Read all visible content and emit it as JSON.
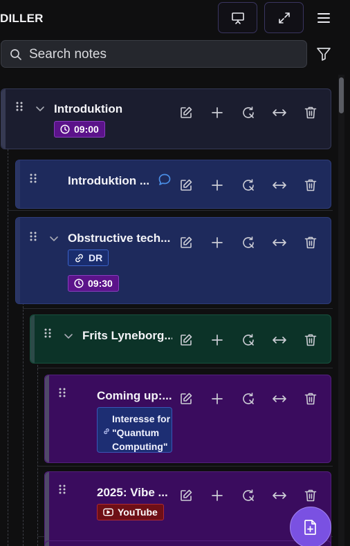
{
  "app": {
    "title": "DILLER"
  },
  "toolbar": {
    "present_icon": "presentation-icon",
    "fullscreen_icon": "expand-icon",
    "menu_icon": "hamburger-menu-icon"
  },
  "search": {
    "placeholder": "Search notes",
    "value": ""
  },
  "filter_icon": "filter-icon",
  "fab_icon": "add-note-icon",
  "colors": {
    "accent": "#7a51e2",
    "card_blue": "#1e2a5c",
    "card_green": "#0c3328",
    "card_purple": "#3a0c5e",
    "time_badge": "#5b138a",
    "youtube_badge": "#6e0f16"
  },
  "notes": [
    {
      "title": "Introduktion",
      "collapsible": true,
      "time": "09:00"
    },
    {
      "title": "Introduktion ...",
      "has_comment": true
    },
    {
      "title": "Obstructive tech...",
      "collapsible": true,
      "link_label": "DR",
      "time": "09:30"
    },
    {
      "title": "Frits Lyneborg...",
      "collapsible": true
    },
    {
      "title": "Coming up:...",
      "link_preview": "Interesse for\n\"Quantum\nComputing\""
    },
    {
      "title": "2025: Vibe ...",
      "youtube_label": "YouTube"
    }
  ],
  "actions": [
    "edit-icon",
    "add-child-icon",
    "refresh-icon",
    "resize-width-icon",
    "delete-icon"
  ]
}
